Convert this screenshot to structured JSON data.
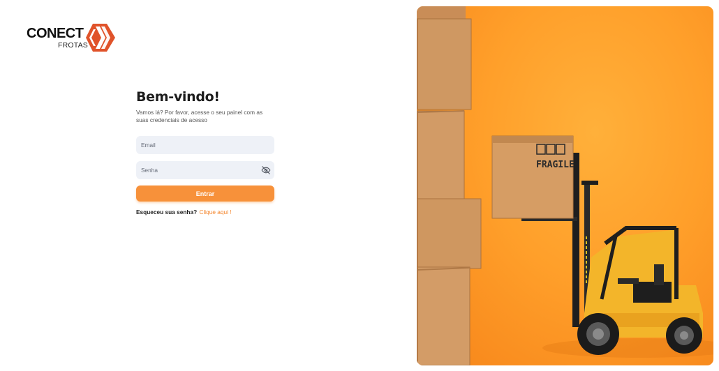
{
  "logo": {
    "name": "CONECT",
    "tagline": "FROTAS",
    "color": "#e0532a"
  },
  "login": {
    "title": "Bem-vindo!",
    "subtitle": "Vamos lá? Por favor, acesse o seu painel com  as suas credenciais  de acesso",
    "email_placeholder": "Email",
    "password_placeholder": "Senha",
    "password_toggle_icon": "eye-off-icon",
    "submit_label": "Entrar",
    "forgot_prompt": "Esqueceu sua senha?",
    "forgot_link": "Clique aqui !",
    "accent_color": "#f7913a",
    "field_background": "#eef1f7"
  },
  "hero": {
    "box_label": "FRAGILE",
    "background_color": "#ff9f2a"
  }
}
